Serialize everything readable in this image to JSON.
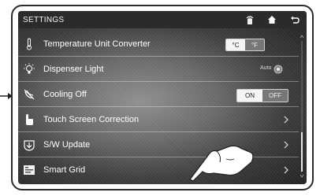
{
  "header": {
    "title": "SETTINGS",
    "icons": [
      "remote-icon",
      "home-icon",
      "back-icon"
    ]
  },
  "rows": [
    {
      "label": "Temperature Unit Converter",
      "icon": "thermometer-icon",
      "control": "toggle",
      "options": [
        "°C",
        "°F"
      ],
      "selected": "°C"
    },
    {
      "label": "Dispenser Light",
      "icon": "light-bulb-icon",
      "control": "auto-toggle",
      "option_label": "Auto"
    },
    {
      "label": "Cooling Off",
      "icon": "cooling-off-icon",
      "control": "toggle",
      "options": [
        "ON",
        "OFF"
      ],
      "selected": "ON"
    },
    {
      "label": "Touch Screen Correction",
      "icon": "touch-icon",
      "control": "chevron"
    },
    {
      "label": "S/W Update",
      "icon": "download-icon",
      "control": "chevron"
    },
    {
      "label": "Smart Grid",
      "icon": "smart-grid-icon",
      "control": "chevron"
    }
  ],
  "colors": {
    "header_bg": "#2b2b2b",
    "text": "#ffffff",
    "toggle_selected": "#f4f4f4",
    "toggle_unselected": "#777777"
  }
}
